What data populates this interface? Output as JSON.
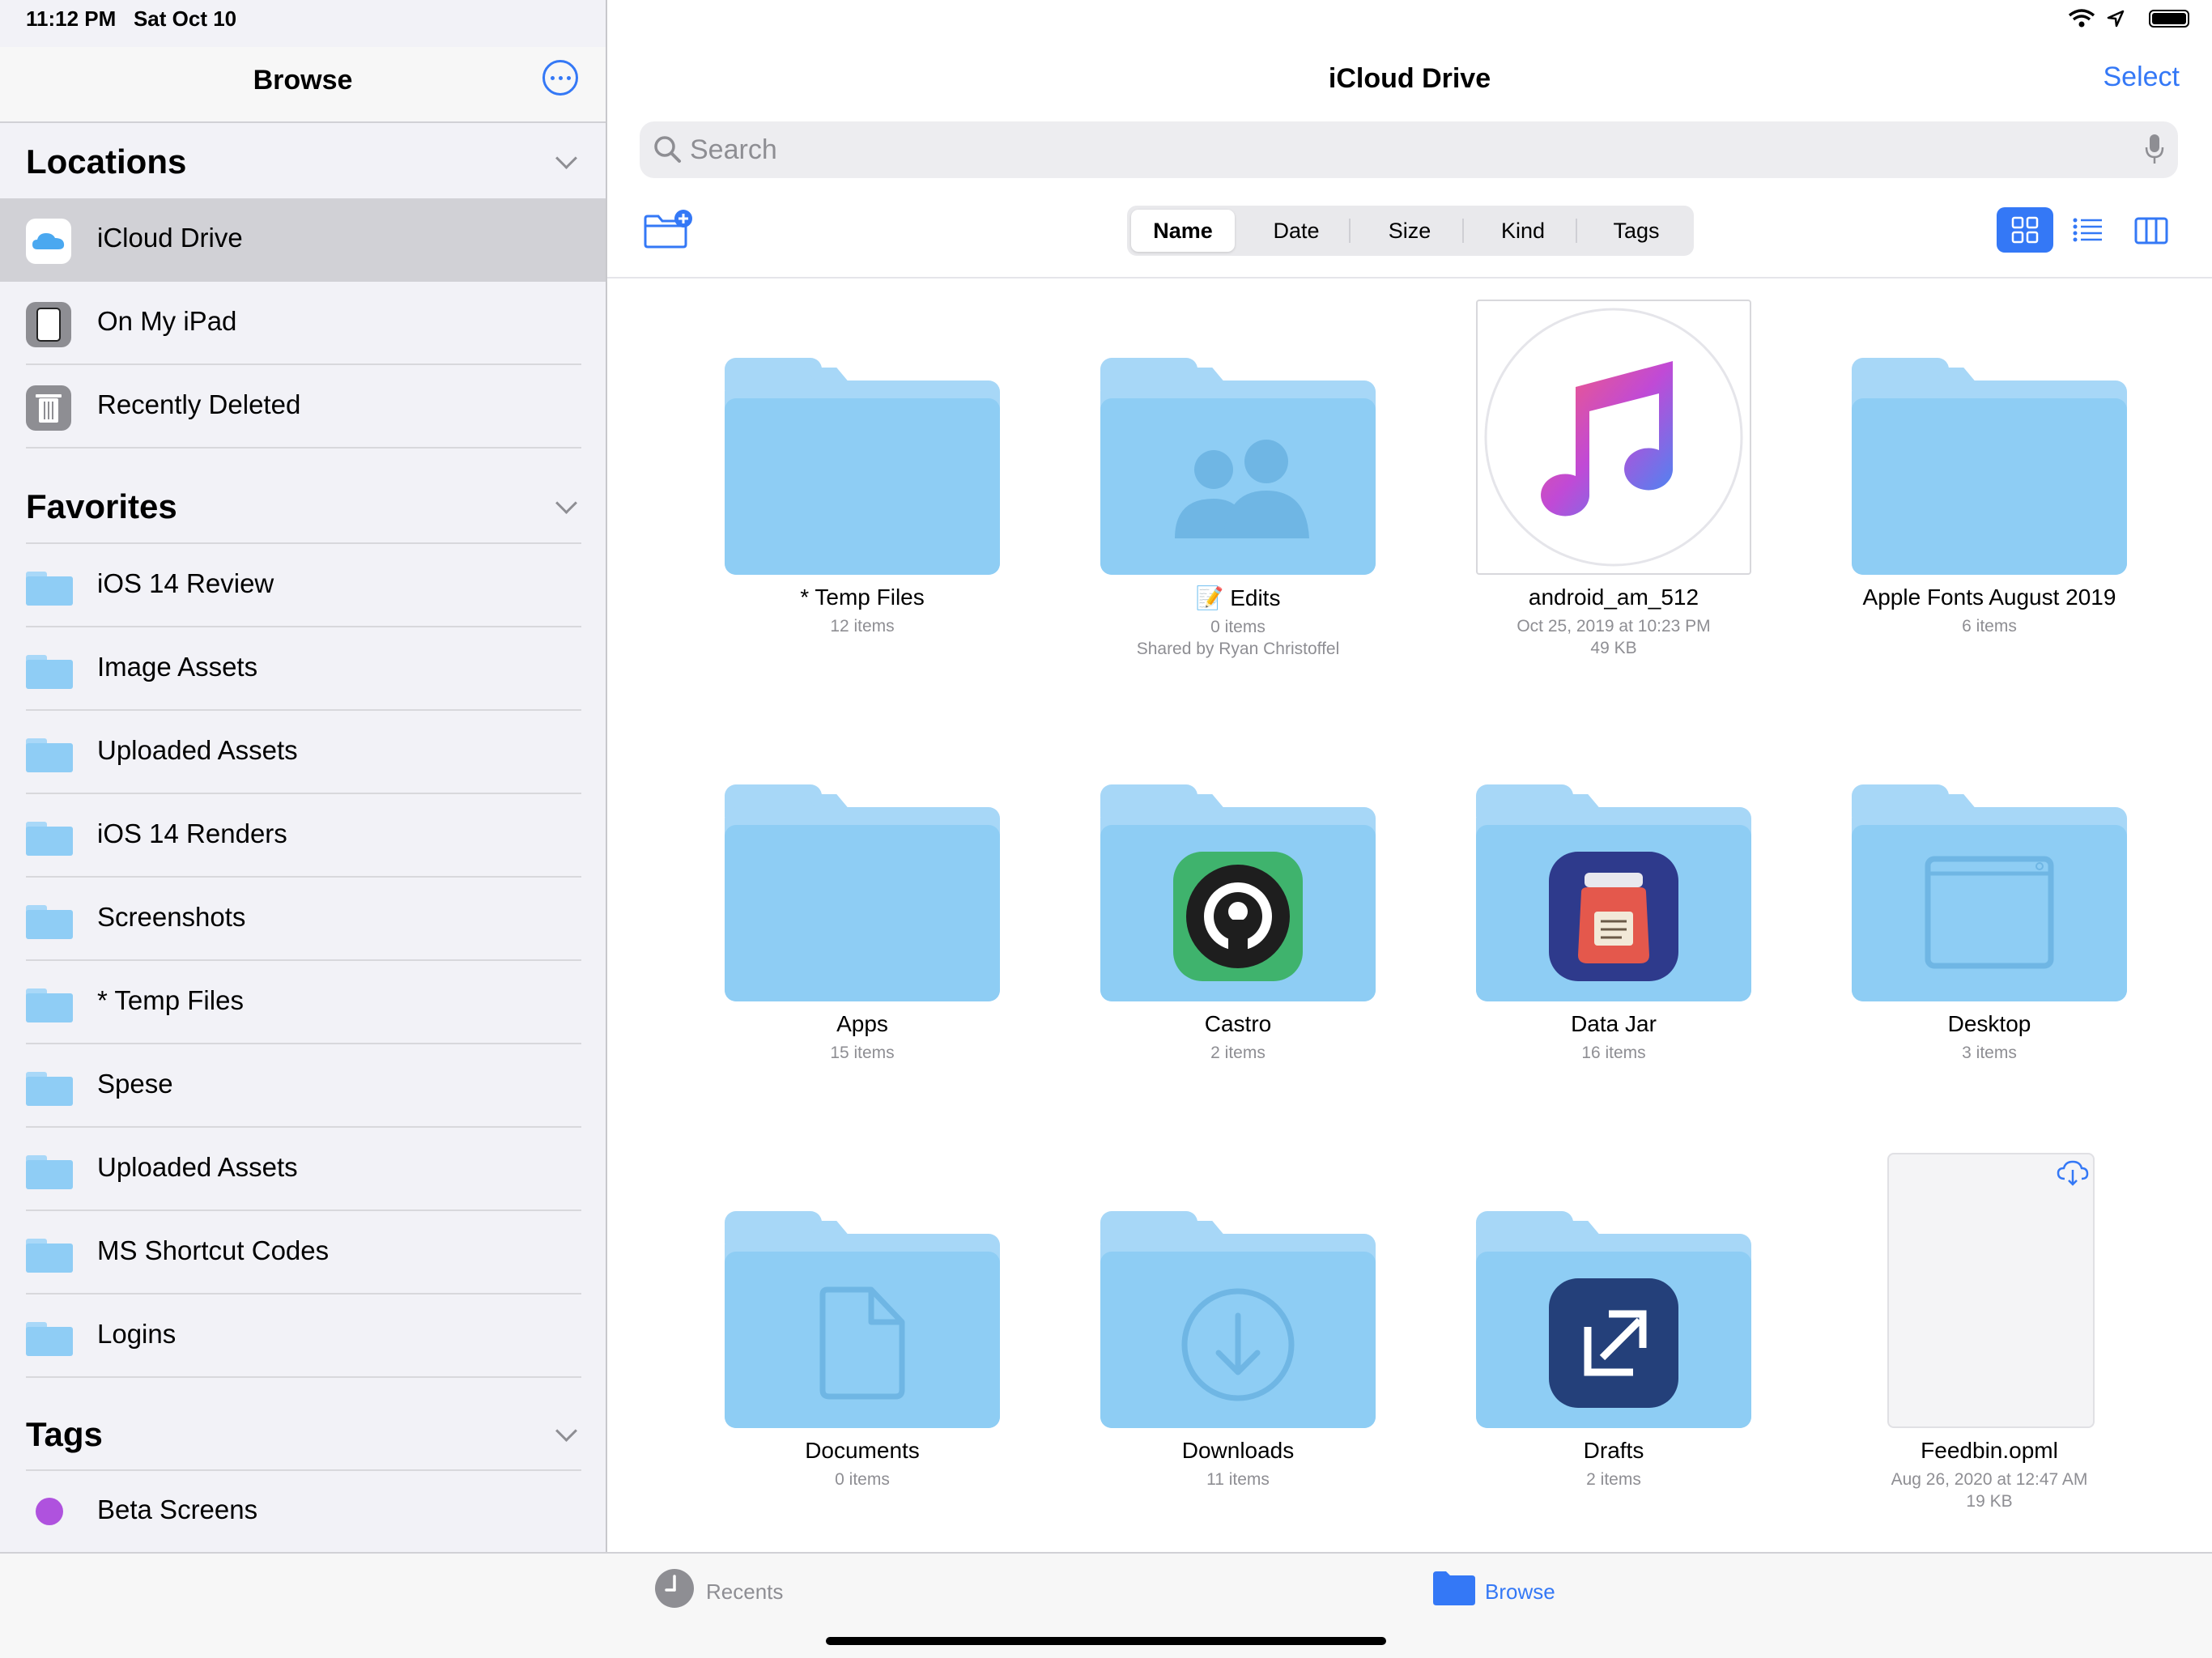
{
  "status": {
    "time": "11:12 PM",
    "date": "Sat Oct 10"
  },
  "sidebar": {
    "title": "Browse",
    "locations_header": "Locations",
    "locations": [
      {
        "label": "iCloud Drive",
        "icon": "icloud-icon",
        "active": true
      },
      {
        "label": "On My iPad",
        "icon": "ipad-icon"
      },
      {
        "label": "Recently Deleted",
        "icon": "trash-icon"
      }
    ],
    "favorites_header": "Favorites",
    "favorites": [
      {
        "label": "iOS 14 Review"
      },
      {
        "label": "Image Assets"
      },
      {
        "label": "Uploaded Assets"
      },
      {
        "label": "iOS 14 Renders"
      },
      {
        "label": "Screenshots"
      },
      {
        "label": "* Temp Files"
      },
      {
        "label": "Spese"
      },
      {
        "label": "Uploaded Assets"
      },
      {
        "label": "MS Shortcut Codes"
      },
      {
        "label": "Logins"
      }
    ],
    "tags_header": "Tags",
    "tags": [
      {
        "label": "Beta Screens",
        "color": "#af52de"
      }
    ]
  },
  "main": {
    "title": "iCloud Drive",
    "select_label": "Select",
    "search": {
      "placeholder": "Search"
    },
    "sort": {
      "options": [
        "Name",
        "Date",
        "Size",
        "Kind",
        "Tags"
      ],
      "selected": "Name"
    },
    "items": [
      {
        "name": "* Temp Files",
        "sub1": "12 items",
        "sub2": ""
      },
      {
        "name": "📝 Edits",
        "sub1": "0 items",
        "sub2": "Shared by Ryan Christoffel"
      },
      {
        "name": "android_am_512",
        "sub1": "Oct 25, 2019 at 10:23 PM",
        "sub2": "49 KB"
      },
      {
        "name": "Apple Fonts August 2019",
        "sub1": "6 items",
        "sub2": ""
      },
      {
        "name": "Apps",
        "sub1": "15 items",
        "sub2": ""
      },
      {
        "name": "Castro",
        "sub1": "2 items",
        "sub2": ""
      },
      {
        "name": "Data Jar",
        "sub1": "16 items",
        "sub2": ""
      },
      {
        "name": "Desktop",
        "sub1": "3 items",
        "sub2": ""
      },
      {
        "name": "Documents",
        "sub1": "0 items",
        "sub2": ""
      },
      {
        "name": "Downloads",
        "sub1": "11 items",
        "sub2": ""
      },
      {
        "name": "Drafts",
        "sub1": "2 items",
        "sub2": ""
      },
      {
        "name": "Feedbin.opml",
        "sub1": "Aug 26, 2020 at 12:47 AM",
        "sub2": "19 KB"
      }
    ]
  },
  "tabbar": {
    "recents": "Recents",
    "browse": "Browse"
  },
  "colors": {
    "accent": "#3478f6",
    "folder": "#8ecdf4"
  }
}
